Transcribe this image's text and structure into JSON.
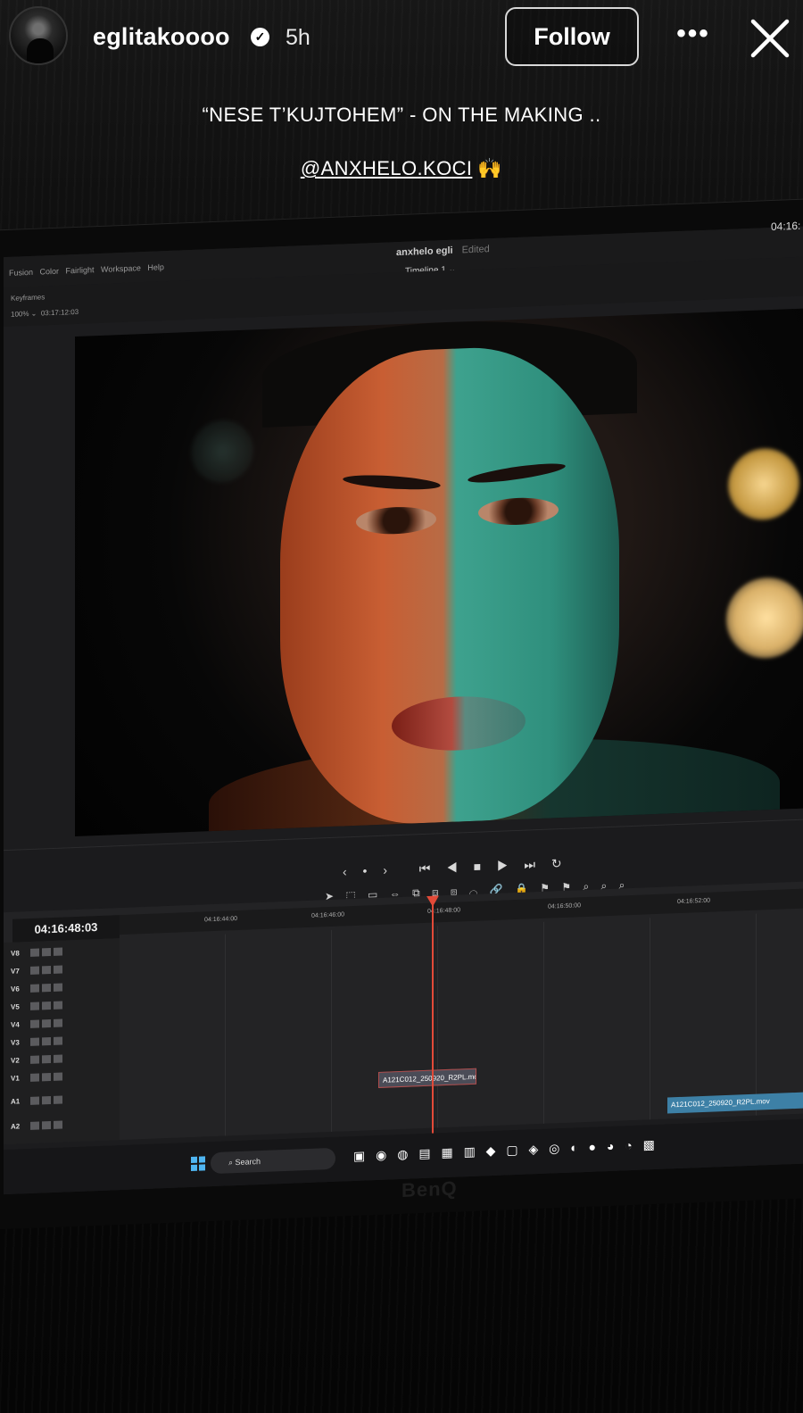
{
  "story": {
    "username": "eglitakoooo",
    "time_ago": "5h",
    "follow_label": "Follow",
    "more_label": "•••",
    "caption_line1": "“NESE T’KUJTOHEM” - ON THE MAKING ..",
    "caption_mention": "@ANXHELO.KOCI",
    "caption_emoji": "🙌"
  },
  "editor": {
    "menu_items": "Fusion  Color  Fairlight  Workspace  Help",
    "project_name": "anxhelo egli",
    "project_status": "Edited",
    "timeline_name": "Timeline 1 ⌄",
    "top_timecode": "04:16:",
    "keyframes_label": "Keyframes",
    "zoom_label": "100% ⌄",
    "viewer_timecode": "03:17:12:03",
    "timeline_timecode": "04:16:48:03",
    "ruler_ticks": [
      "04:16:44:00",
      "04:16:46:00",
      "04:16:48:00",
      "04:16:50:00",
      "04:16:52:00"
    ],
    "tracks": [
      "V8",
      "V7",
      "V6",
      "V5",
      "V4",
      "V3",
      "V2",
      "V1",
      "A1",
      "A2"
    ],
    "clip_a": "A121C012_250920_R2PL.mov",
    "clip_b": "A121C012_250920_R2PL.mov"
  },
  "taskbar": {
    "search_label": "Search"
  },
  "monitor_brand": "BenQ"
}
